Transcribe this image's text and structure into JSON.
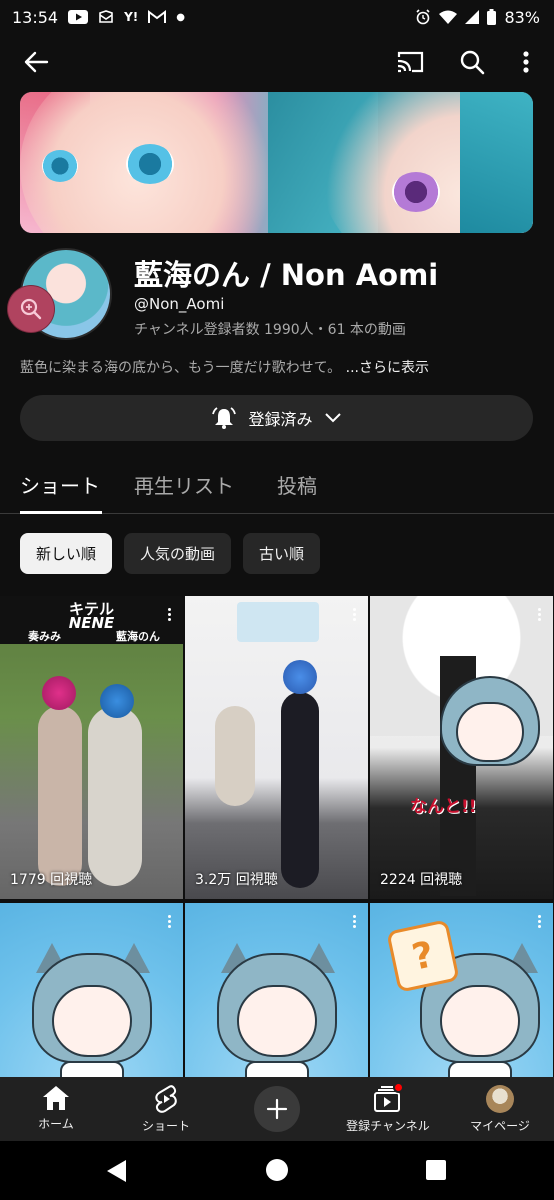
{
  "status": {
    "time": "13:54",
    "yahoo": "Y!",
    "battery": "83%"
  },
  "channel": {
    "name": "藍海のん / Non Aomi",
    "handle": "@Non_Aomi",
    "stats": "チャンネル登録者数 1990人・61 本の動画",
    "description": "藍色に染まる海の底から、もう一度だけ歌わせて。",
    "more_label": "...さらに表示",
    "subscribe_label": "登録済み"
  },
  "tabs": [
    "ショート",
    "再生リスト",
    "投稿"
  ],
  "chips": [
    "新しい順",
    "人気の動画",
    "古い順"
  ],
  "shorts": [
    {
      "views": "1779 回視聴",
      "title_line1": "キテル",
      "title_line2": "NENE",
      "sub_left": "奏みみ",
      "sub_right": "藍海のん"
    },
    {
      "views": "3.2万 回視聴"
    },
    {
      "views": "2224 回視聴",
      "caption": "なんと!!"
    },
    {
      "views": ""
    },
    {
      "views": ""
    },
    {
      "views": "",
      "badge": "?"
    }
  ],
  "bottom_nav": [
    {
      "label": "ホーム",
      "icon": "home-icon"
    },
    {
      "label": "ショート",
      "icon": "shorts-icon"
    },
    {
      "label": "",
      "icon": "create-icon"
    },
    {
      "label": "登録チャンネル",
      "icon": "subscriptions-icon"
    },
    {
      "label": "マイページ",
      "icon": "account-avatar"
    }
  ],
  "colors": {
    "background": "#0f0f0f",
    "surface": "#272727",
    "secondary_text": "#aaaaaa",
    "notification_dot": "#ff0000"
  }
}
